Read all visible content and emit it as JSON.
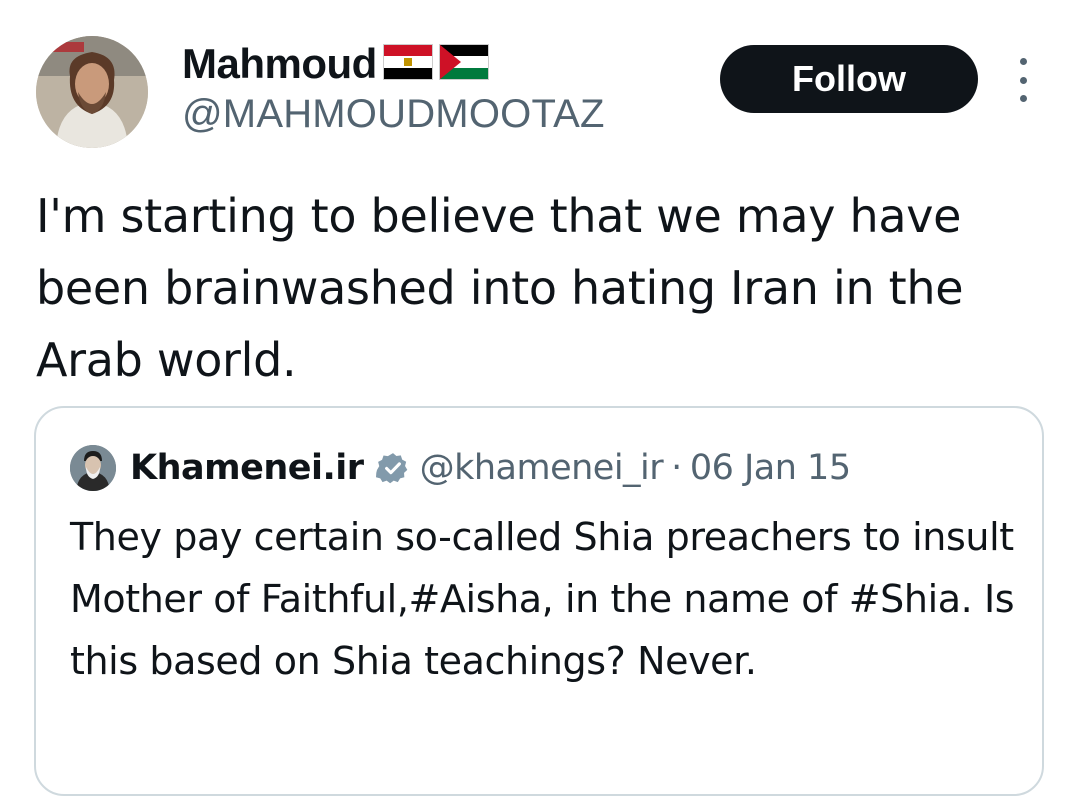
{
  "author": {
    "display_name": "Mahmoud",
    "flags": [
      "egypt-flag",
      "palestine-flag"
    ],
    "handle": "@MAHMOUDMOOTAZ",
    "avatar": "profile-photo"
  },
  "actions": {
    "follow_label": "Follow",
    "more_icon": "more-vertical-icon"
  },
  "tweet": {
    "text": "I'm starting to believe that we may have been brainwashed into hating Iran in the Arab world."
  },
  "quoted_tweet": {
    "display_name": "Khamenei.ir",
    "verified_icon": "verified-badge-icon",
    "handle": "@khamenei_ir",
    "separator": "·",
    "date": "06 Jan 15",
    "text": "They pay certain so-called Shia preachers to insult Mother of Faithful,#Aisha, in the name of #Shia. Is this based on Shia teachings? Never."
  },
  "colors": {
    "text_primary": "#0f1419",
    "text_secondary": "#536471",
    "button_bg": "#0f1419",
    "border": "#cfd9de",
    "verified_gray": "#829aab"
  }
}
